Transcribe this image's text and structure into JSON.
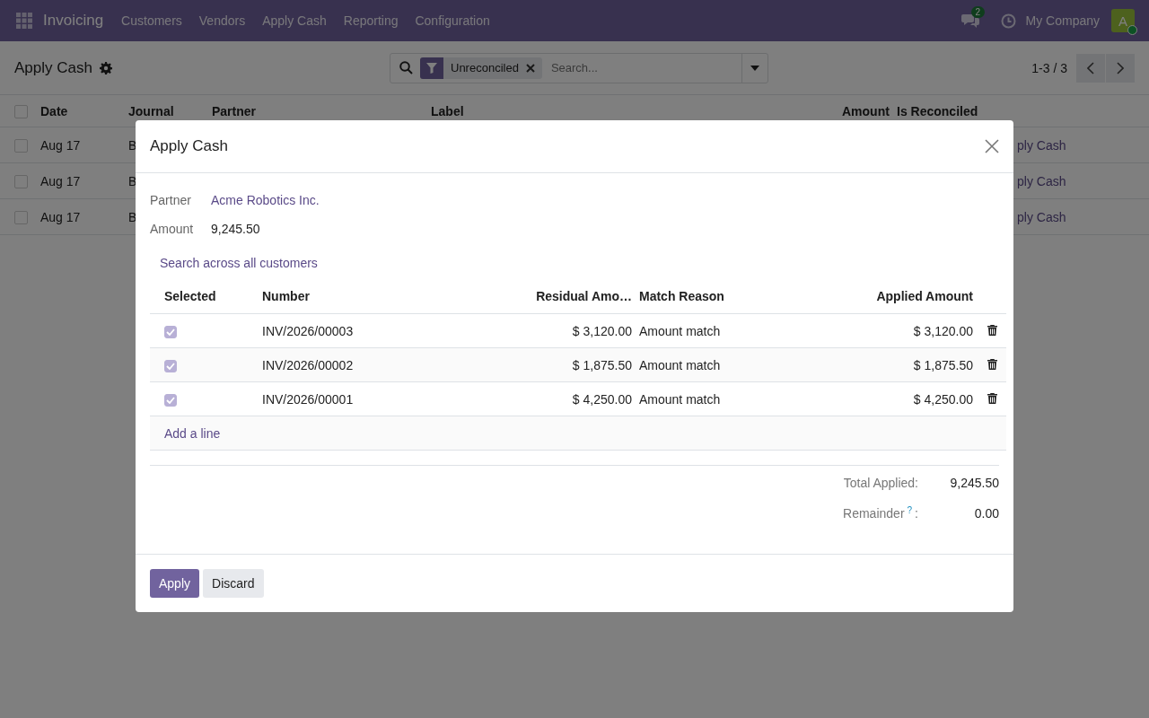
{
  "navbar": {
    "app": "Invoicing",
    "menu": [
      "Customers",
      "Vendors",
      "Apply Cash",
      "Reporting",
      "Configuration"
    ],
    "messages_count": "2",
    "company": "My Company",
    "avatar": "A"
  },
  "control_panel": {
    "title": "Apply Cash",
    "search": {
      "facet": "Unreconciled",
      "placeholder": "Search..."
    },
    "pager": "1-3 / 3"
  },
  "list": {
    "select_all": false,
    "columns": [
      "Date",
      "Journal",
      "Partner",
      "Label",
      "Amount",
      "Is Reconciled"
    ],
    "rows": [
      {
        "selected": false,
        "date": "Aug 17",
        "journal": "B",
        "action": "ply Cash"
      },
      {
        "selected": false,
        "date": "Aug 17",
        "journal": "B",
        "action": "ply Cash"
      },
      {
        "selected": false,
        "date": "Aug 17",
        "journal": "B",
        "action": "ply Cash"
      }
    ]
  },
  "dialog": {
    "title": "Apply Cash",
    "fields": [
      {
        "label": "Partner",
        "value": "Acme Robotics Inc.",
        "kind": "link"
      },
      {
        "label": "Amount",
        "value": "9,245.50",
        "kind": "text"
      }
    ],
    "search_link": "Search across all customers",
    "table": {
      "columns": [
        "Selected",
        "Number",
        "Residual Amo…",
        "Match Reason",
        "Applied Amount"
      ],
      "rows": [
        {
          "selected": true,
          "number": "INV/2026/00003",
          "residual": "$ 3,120.00",
          "reason": "Amount match",
          "applied": "$ 3,120.00"
        },
        {
          "selected": true,
          "number": "INV/2026/00002",
          "residual": "$ 1,875.50",
          "reason": "Amount match",
          "applied": "$ 1,875.50"
        },
        {
          "selected": true,
          "number": "INV/2026/00001",
          "residual": "$ 4,250.00",
          "reason": "Amount match",
          "applied": "$ 4,250.00"
        }
      ],
      "add_line": "Add a line"
    },
    "totals": [
      {
        "label": "Total Applied:",
        "value": "9,245.50"
      },
      {
        "label": "Remainder",
        "help": "?",
        "suffix": ":",
        "value": "0.00"
      }
    ],
    "buttons": [
      {
        "label": "Apply",
        "kind": "primary"
      },
      {
        "label": "Discard",
        "kind": "secondary"
      }
    ]
  }
}
